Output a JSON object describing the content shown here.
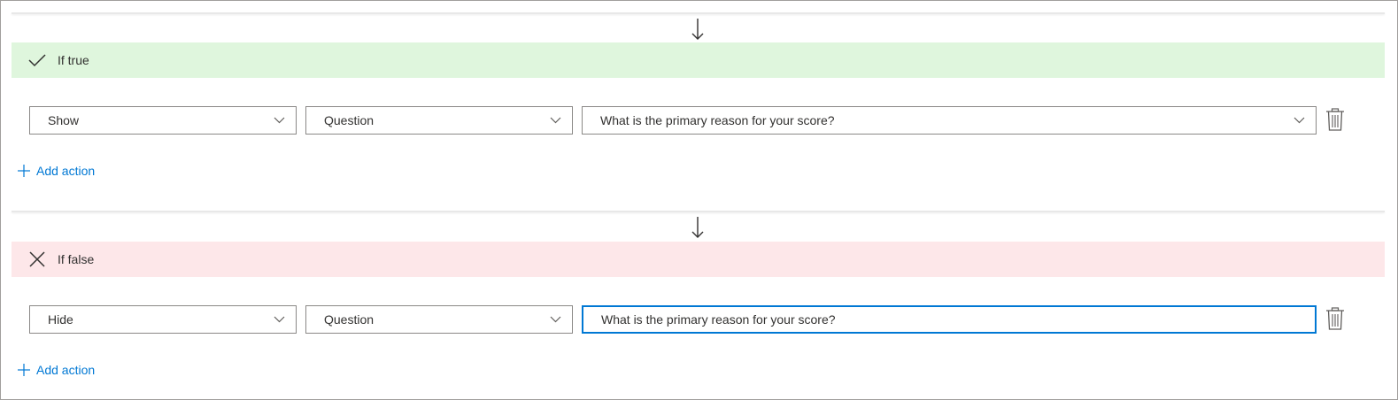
{
  "branches": {
    "true_branch": {
      "label": "If true",
      "header_color": "#dff6dd",
      "icon": "checkmark-icon",
      "action": {
        "type_value": "Show",
        "target_value": "Question",
        "question_value": "What is the primary reason for your score?"
      },
      "add_action_label": "Add action"
    },
    "false_branch": {
      "label": "If false",
      "header_color": "#fde7e9",
      "icon": "close-icon",
      "action": {
        "type_value": "Hide",
        "target_value": "Question",
        "question_value": "What is the primary reason for your score?"
      },
      "add_action_label": "Add action"
    }
  },
  "colors": {
    "accent": "#0078d4",
    "border": "#8a8886",
    "text": "#323130"
  }
}
